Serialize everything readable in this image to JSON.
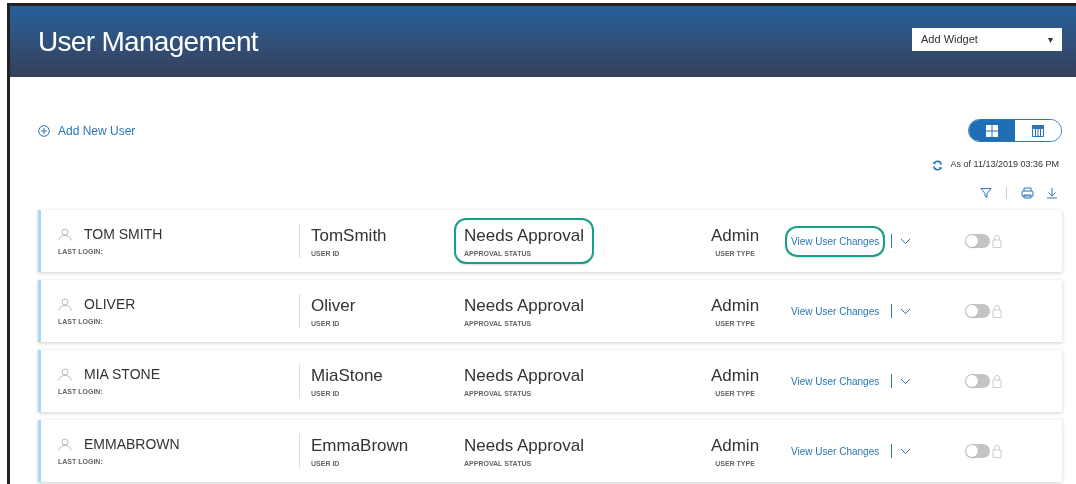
{
  "header": {
    "title": "User Management",
    "widget_select": {
      "value": "Add Widget",
      "arrow": "▾"
    }
  },
  "add_user": {
    "label": "Add New User"
  },
  "view_modes": [
    {
      "kind": "grid",
      "selected": true
    },
    {
      "kind": "table",
      "selected": false
    }
  ],
  "timestamp": "As of 11/13/2019 03:36 PM",
  "users": [
    {
      "name": "TOM SMITH",
      "last_login_label": "LAST LOGIN:",
      "user_id": "TomSmith",
      "user_id_label": "USER ID",
      "status": "Needs Approval",
      "status_label": "APPROVAL STATUS",
      "status_highlighted": true,
      "type": "Admin",
      "type_label": "USER TYPE",
      "link": "View User Changes",
      "link_highlighted": true,
      "on": false
    },
    {
      "name": "OLIVER",
      "last_login_label": "LAST LOGIN:",
      "user_id": "Oliver",
      "user_id_label": "USER ID",
      "status": "Needs Approval",
      "status_label": "APPROVAL STATUS",
      "status_highlighted": false,
      "type": "Admin",
      "type_label": "USER TYPE",
      "link": "View User Changes",
      "link_highlighted": false,
      "on": false
    },
    {
      "name": "MIA STONE",
      "last_login_label": "LAST LOGIN:",
      "user_id": "MiaStone",
      "user_id_label": "USER ID",
      "status": "Needs Approval",
      "status_label": "APPROVAL STATUS",
      "status_highlighted": false,
      "type": "Admin",
      "type_label": "USER TYPE",
      "link": "View User Changes",
      "link_highlighted": false,
      "on": false
    },
    {
      "name": "EMMABROWN",
      "last_login_label": "LAST LOGIN:",
      "user_id": "EmmaBrown",
      "user_id_label": "USER ID",
      "status": "Needs Approval",
      "status_label": "APPROVAL STATUS",
      "status_highlighted": false,
      "type": "Admin",
      "type_label": "USER TYPE",
      "link": "View User Changes",
      "link_highlighted": false,
      "on": false
    }
  ]
}
